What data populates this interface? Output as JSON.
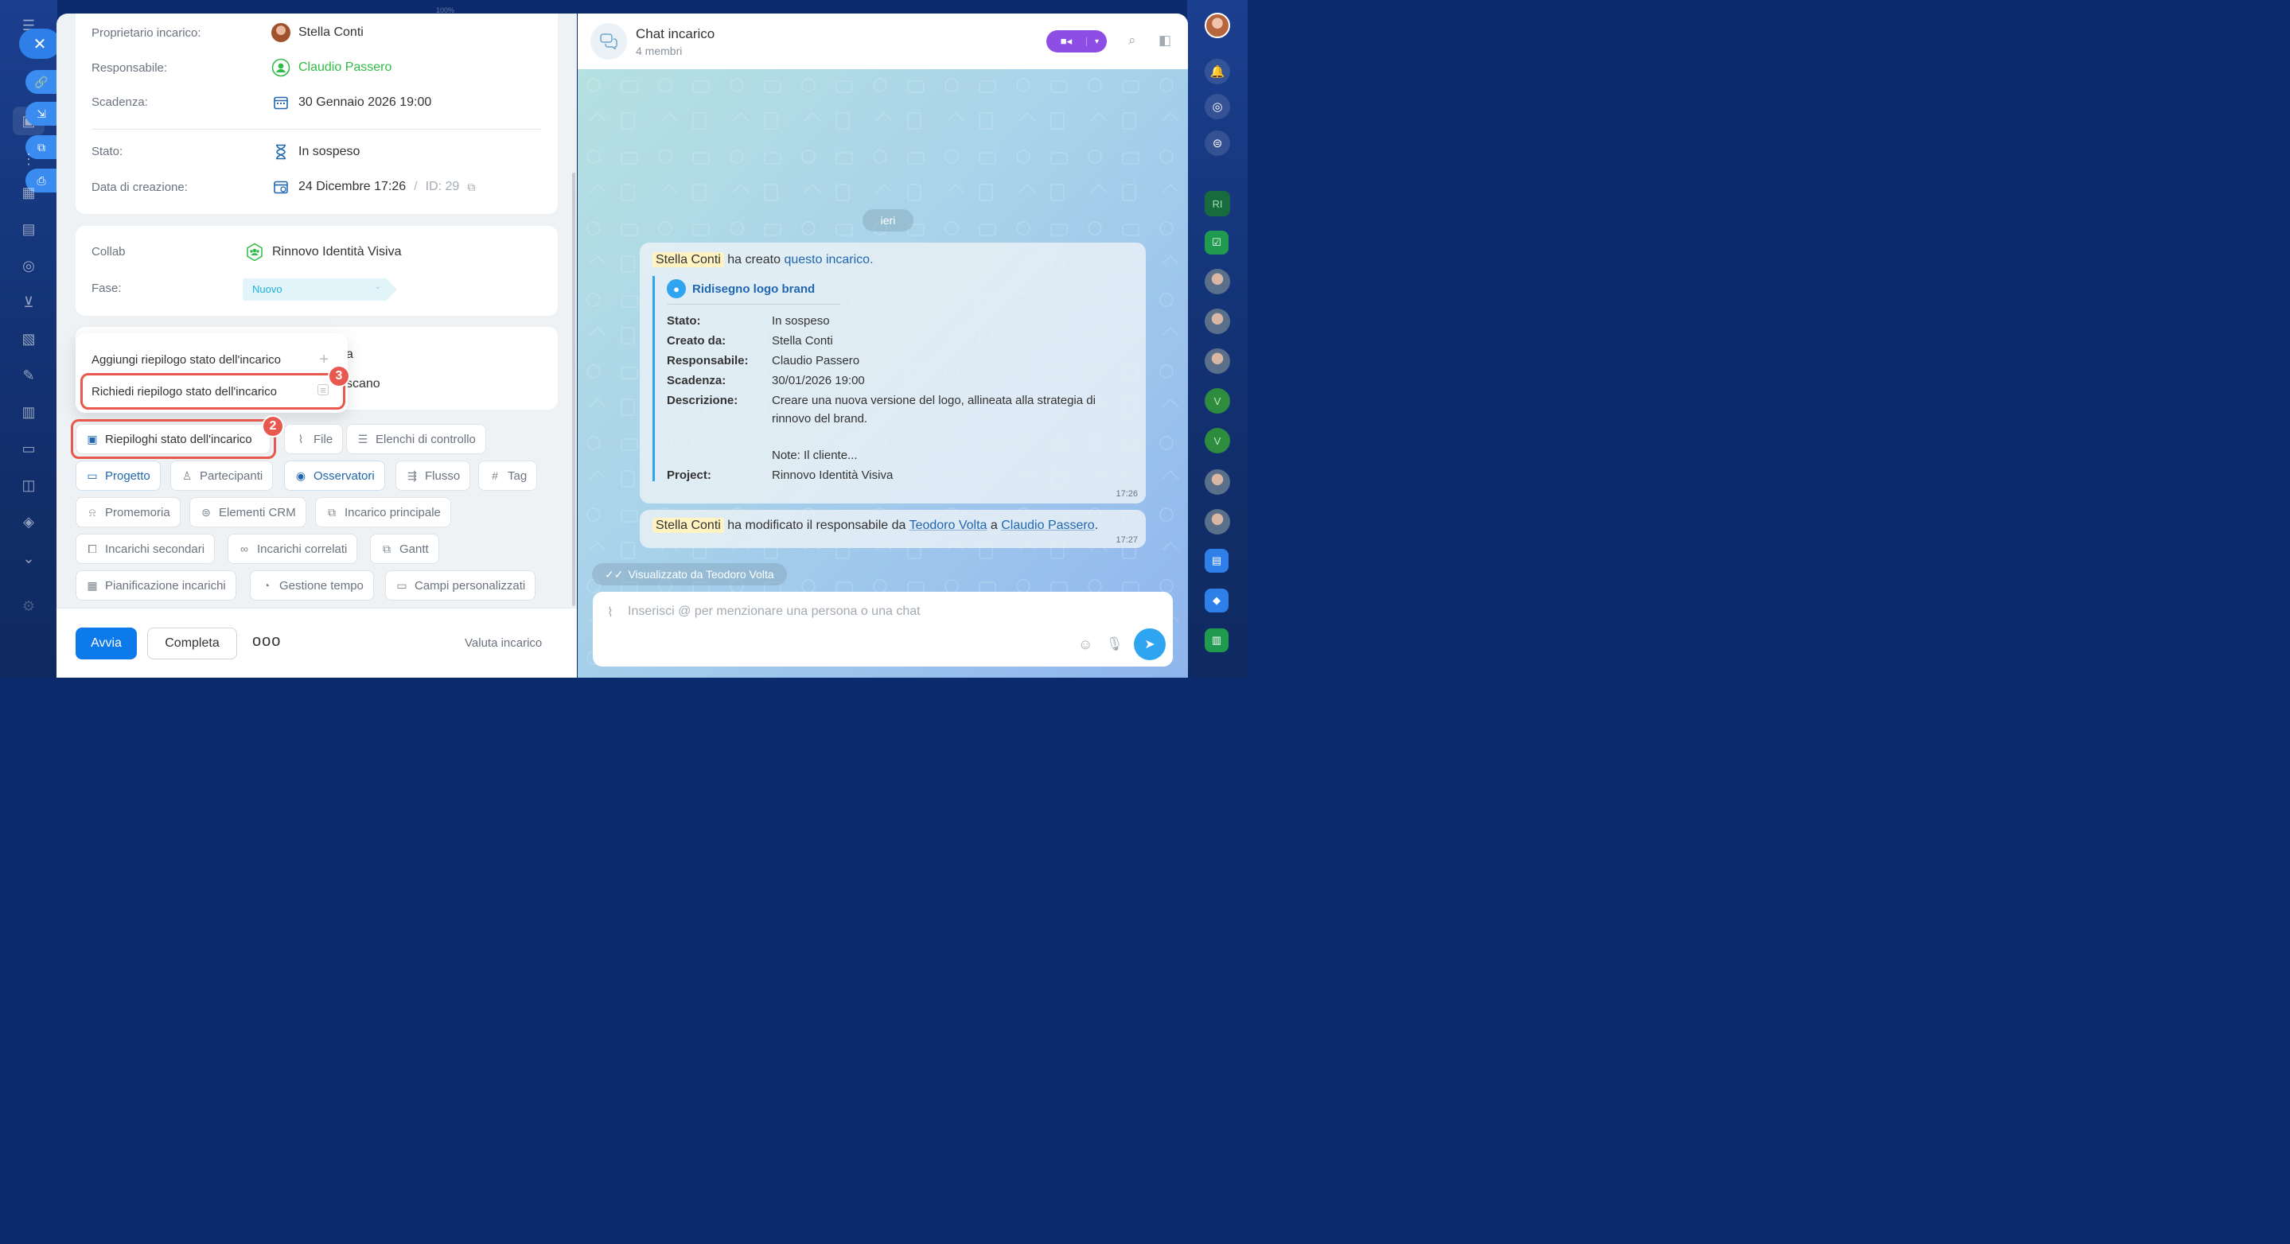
{
  "top": {
    "zoom_text": "100%"
  },
  "left_rail": {
    "icons": [
      "menu-icon",
      "task-icon",
      "link-icon",
      "download-icon",
      "external-link-icon",
      "print-icon",
      "hierarchy-icon",
      "calendar-grid-icon",
      "archive-icon",
      "target-icon",
      "cart-icon",
      "document-edit-icon",
      "pen-icon",
      "bar-chart-icon",
      "card-icon",
      "robot-icon",
      "box-icon",
      "chevron-down-icon",
      "settings-icon"
    ],
    "close_symbol": "✕"
  },
  "task": {
    "fields": {
      "owner_label": "Proprietario incarico:",
      "owner_value": "Stella Conti",
      "responsible_label": "Responsabile:",
      "responsible_value": "Claudio Passero",
      "deadline_label": "Scadenza:",
      "deadline_value": "30 Gennaio 2026 19:00",
      "status_label": "Stato:",
      "status_value": "In sospeso",
      "created_label": "Data di creazione:",
      "created_value": "24 Dicembre 17:26",
      "separator": "/",
      "id_value": "ID: 29"
    },
    "collab": {
      "collab_label": "Collab",
      "collab_value": "Rinnovo Identità Visiva",
      "phase_label": "Fase:",
      "phase_value": "Nuovo"
    },
    "hidden_card": {
      "partial_1": "a",
      "partial_2": "scano"
    },
    "popup": {
      "add_summary": "Aggiungi riepilogo stato dell'incarico",
      "request_summary": "Richiedi riepilogo stato dell'incarico"
    },
    "badges": {
      "step2": "2",
      "step3": "3"
    },
    "chips": {
      "status_summaries": "Riepiloghi stato dell'incarico",
      "file": "File",
      "checklists": "Elenchi di controllo",
      "project": "Progetto",
      "participants": "Partecipanti",
      "observers": "Osservatori",
      "flow": "Flusso",
      "tag": "Tag",
      "reminder": "Promemoria",
      "crm": "Elementi CRM",
      "parent_task": "Incarico principale",
      "subtasks": "Incarichi secondari",
      "related_tasks": "Incarichi correlati",
      "gantt": "Gantt",
      "planning": "Pianificazione incarichi",
      "time_tracking": "Gestione tempo",
      "custom_fields": "Campi personalizzati"
    },
    "footer": {
      "start": "Avvia",
      "complete": "Completa",
      "more": "ooo",
      "rate": "Valuta incarico"
    }
  },
  "chat": {
    "title": "Chat incarico",
    "members": "4 membri",
    "date_divider": "ieri",
    "message1": {
      "author": "Stella Conti",
      "action": "ha creato",
      "link": "questo incarico.",
      "task_title": "Ridisegno logo brand",
      "rows": [
        {
          "label": "Stato:",
          "value": "In sospeso"
        },
        {
          "label": "Creato da:",
          "value": "Stella Conti"
        },
        {
          "label": "Responsabile:",
          "value": "Claudio Passero"
        },
        {
          "label": "Scadenza:",
          "value": "30/01/2026 19:00"
        },
        {
          "label": "Descrizione:",
          "value": "Creare una nuova versione del logo, allineata alla strategia di"
        }
      ],
      "desc_line2": "rinnovo del brand.",
      "desc_note": "Note: Il cliente...",
      "project_label": "Project:",
      "project_value": "Rinnovo Identità Visiva",
      "time": "17:26"
    },
    "message2": {
      "author": "Stella Conti",
      "action": "ha modificato il responsabile da",
      "from": "Teodoro Volta",
      "conj": "a",
      "to": "Claudio Passero",
      "dot": ".",
      "time": "17:27"
    },
    "seen": "Visualizzato da Teodoro Volta",
    "composer_placeholder": "Inserisci @ per menzionare una persona o una chat"
  },
  "right_rail": {
    "project_initials": "RI",
    "v_letter": "V",
    "accent": "#2fa4f0",
    "danger": "#e8584f",
    "primary": "#0c7aea"
  }
}
